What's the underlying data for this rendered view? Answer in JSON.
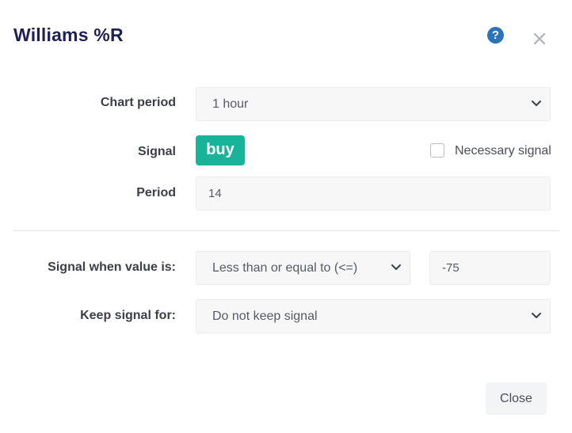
{
  "dialog": {
    "title": "Williams %R",
    "help_icon": "question-circle-icon",
    "close_icon": "close-x-icon"
  },
  "form": {
    "chart_period": {
      "label": "Chart period",
      "value": "1 hour"
    },
    "signal": {
      "label": "Signal",
      "badge": "buy",
      "badge_color": "#17b49a",
      "necessary_signal_label": "Necessary signal",
      "necessary_signal_checked": false
    },
    "period": {
      "label": "Period",
      "value": "14"
    },
    "signal_when": {
      "label": "Signal when value is:",
      "operator": "Less than or equal to (<=)",
      "value": "-75"
    },
    "keep_signal": {
      "label": "Keep signal for:",
      "value": "Do not keep signal"
    }
  },
  "footer": {
    "close_label": "Close"
  },
  "colors": {
    "title": "#1f2055",
    "help_icon": "#2a74b8",
    "buy_badge": "#17b49a"
  }
}
